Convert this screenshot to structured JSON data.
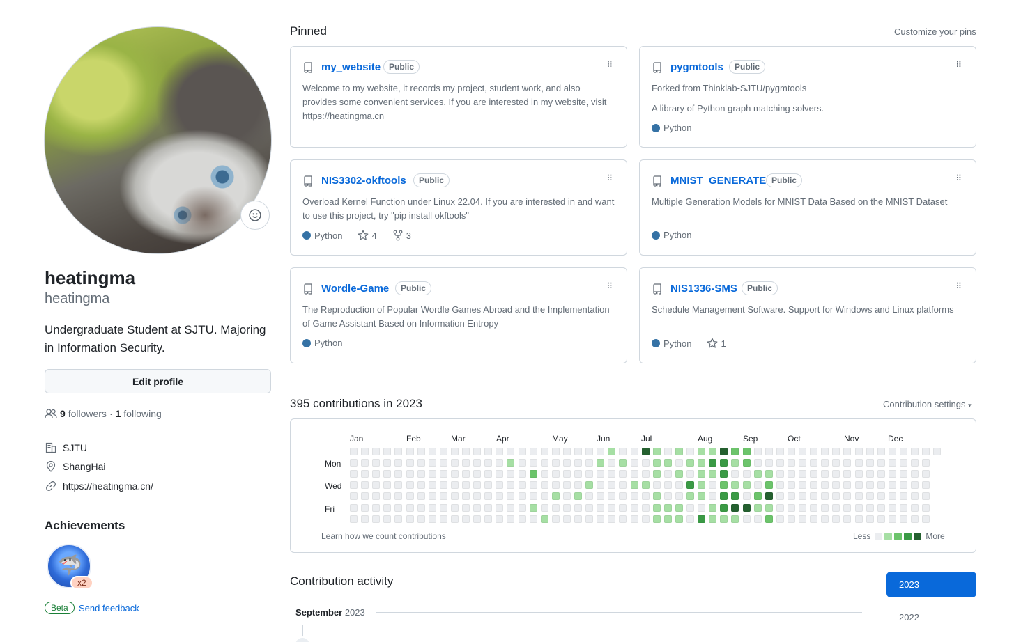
{
  "profile": {
    "fullname": "heatingma",
    "username": "heatingma",
    "bio": "Undergraduate Student at SJTU. Majoring in Information Security.",
    "edit_label": "Edit profile",
    "followers_count": "9",
    "followers_label": "followers",
    "dot": "·",
    "following_count": "1",
    "following_label": "following",
    "org": "SJTU",
    "location": "ShangHai",
    "website": "https://heatingma.cn/"
  },
  "achievements": {
    "title": "Achievements",
    "count": "x2",
    "beta_label": "Beta",
    "feedback_label": "Send feedback"
  },
  "pinned": {
    "title": "Pinned",
    "customize_label": "Customize your pins",
    "cards": [
      {
        "name": "my_website",
        "visibility": "Public",
        "desc": "Welcome to my website, it records my project, student work, and also provides some convenient services. If you are interested in my website, visit https://heatingma.cn",
        "extra": "",
        "language": "",
        "stars": "",
        "forks": ""
      },
      {
        "name": "pygmtools",
        "visibility": "Public",
        "desc": "Forked from Thinklab-SJTU/pygmtools",
        "extra": "A library of Python graph matching solvers.",
        "language": "Python",
        "stars": "",
        "forks": ""
      },
      {
        "name": "NIS3302-okftools",
        "visibility": "Public",
        "desc": "Overload Kernel Function under Linux 22.04. If you are interested in and want to use this project, try \"pip install okftools\"",
        "extra": "",
        "language": "Python",
        "stars": "4",
        "forks": "3"
      },
      {
        "name": "MNIST_GENERATE",
        "visibility": "Public",
        "desc": "Multiple Generation Models for MNIST Data Based on the MNIST Dataset",
        "extra": "",
        "language": "Python",
        "stars": "",
        "forks": ""
      },
      {
        "name": "Wordle-Game",
        "visibility": "Public",
        "desc": "The Reproduction of Popular Wordle Games Abroad and the Implementation of Game Assistant Based on Information Entropy",
        "extra": "",
        "language": "Python",
        "stars": "",
        "forks": ""
      },
      {
        "name": "NIS1336-SMS",
        "visibility": "Public",
        "desc": "Schedule Management Software. Support for Windows and Linux platforms",
        "extra": "",
        "language": "Python",
        "stars": "1",
        "forks": ""
      }
    ]
  },
  "contributions": {
    "title": "395 contributions in 2023",
    "settings_label": "Contribution settings",
    "months": [
      "Jan",
      "Feb",
      "Mar",
      "Apr",
      "May",
      "Jun",
      "Jul",
      "Aug",
      "Sep",
      "Oct",
      "Nov",
      "Dec"
    ],
    "days": [
      "Mon",
      "Wed",
      "Fri"
    ],
    "learn_label": "Learn how we count contributions",
    "less_label": "Less",
    "more_label": "More",
    "colors": [
      "#ebedf0",
      "#9be9a8",
      "#40c463",
      "#30a14e",
      "#216e39"
    ],
    "display_colors": [
      "#ebedf0",
      "#a6dfa4",
      "#6cc46b",
      "#3a9a45",
      "#24602f"
    ],
    "active": [
      [
        14,
        1,
        1
      ],
      [
        16,
        2,
        2
      ],
      [
        18,
        4,
        1
      ],
      [
        20,
        4,
        1
      ],
      [
        23,
        0,
        1
      ],
      [
        16,
        5,
        1
      ],
      [
        17,
        6,
        1
      ],
      [
        21,
        3,
        1
      ],
      [
        22,
        1,
        1
      ],
      [
        24,
        1,
        1
      ],
      [
        25,
        3,
        1
      ],
      [
        26,
        3,
        1
      ],
      [
        27,
        1,
        1
      ],
      [
        27,
        5,
        1
      ],
      [
        27,
        6,
        1
      ],
      [
        26,
        3,
        1
      ],
      [
        26,
        0,
        4
      ],
      [
        27,
        0,
        1
      ],
      [
        28,
        1,
        1
      ],
      [
        27,
        2,
        1
      ],
      [
        27,
        4,
        1
      ],
      [
        28,
        5,
        1
      ],
      [
        28,
        6,
        1
      ],
      [
        29,
        0,
        1
      ],
      [
        30,
        3,
        3
      ],
      [
        30,
        4,
        1
      ],
      [
        29,
        5,
        1
      ],
      [
        29,
        2,
        1
      ],
      [
        29,
        6,
        1
      ],
      [
        31,
        0,
        1
      ],
      [
        31,
        1,
        1
      ],
      [
        31,
        2,
        1
      ],
      [
        31,
        3,
        1
      ],
      [
        31,
        4,
        1
      ],
      [
        31,
        6,
        3
      ],
      [
        30,
        1,
        1
      ],
      [
        32,
        0,
        1
      ],
      [
        32,
        1,
        3
      ],
      [
        32,
        2,
        1
      ],
      [
        32,
        5,
        1
      ],
      [
        32,
        6,
        1
      ],
      [
        33,
        0,
        4
      ],
      [
        33,
        1,
        3
      ],
      [
        33,
        2,
        3
      ],
      [
        33,
        3,
        2
      ],
      [
        33,
        4,
        3
      ],
      [
        33,
        5,
        3
      ],
      [
        33,
        6,
        1
      ],
      [
        34,
        0,
        2
      ],
      [
        34,
        1,
        1
      ],
      [
        34,
        3,
        1
      ],
      [
        34,
        4,
        3
      ],
      [
        34,
        5,
        4
      ],
      [
        34,
        6,
        1
      ],
      [
        35,
        0,
        2
      ],
      [
        35,
        1,
        2
      ],
      [
        35,
        3,
        1
      ],
      [
        35,
        5,
        4
      ],
      [
        36,
        4,
        2
      ],
      [
        36,
        5,
        1
      ],
      [
        36,
        2,
        1
      ],
      [
        37,
        2,
        1
      ],
      [
        37,
        3,
        2
      ],
      [
        37,
        4,
        4
      ],
      [
        37,
        5,
        1
      ],
      [
        37,
        6,
        2
      ]
    ]
  },
  "activity": {
    "title": "Contribution activity",
    "month_label": "September",
    "month_year": "2023",
    "years": [
      "2023",
      "2022"
    ]
  }
}
